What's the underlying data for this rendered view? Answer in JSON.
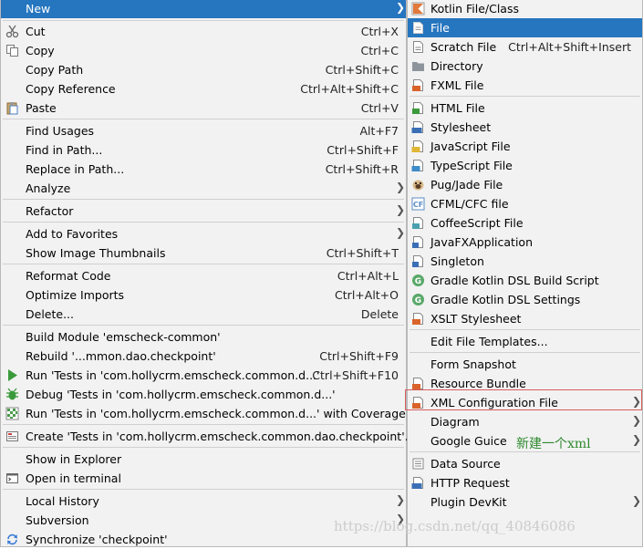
{
  "main_menu": {
    "new": "New",
    "cut": {
      "label": "Cut",
      "shortcut": "Ctrl+X"
    },
    "copy": {
      "label": "Copy",
      "shortcut": "Ctrl+C"
    },
    "copy_path": {
      "label": "Copy Path",
      "shortcut": "Ctrl+Shift+C"
    },
    "copy_reference": {
      "label": "Copy Reference",
      "shortcut": "Ctrl+Alt+Shift+C"
    },
    "paste": {
      "label": "Paste",
      "shortcut": "Ctrl+V"
    },
    "find_usages": {
      "label": "Find Usages",
      "shortcut": "Alt+F7"
    },
    "find_in_path": {
      "label": "Find in Path...",
      "shortcut": "Ctrl+Shift+F"
    },
    "replace_in_path": {
      "label": "Replace in Path...",
      "shortcut": "Ctrl+Shift+R"
    },
    "analyze": "Analyze",
    "refactor": "Refactor",
    "add_to_favorites": "Add to Favorites",
    "show_thumbnails": {
      "label": "Show Image Thumbnails",
      "shortcut": "Ctrl+Shift+T"
    },
    "reformat_code": {
      "label": "Reformat Code",
      "shortcut": "Ctrl+Alt+L"
    },
    "optimize_imports": {
      "label": "Optimize Imports",
      "shortcut": "Ctrl+Alt+O"
    },
    "delete": {
      "label": "Delete...",
      "shortcut": "Delete"
    },
    "build_module": "Build Module 'emscheck-common'",
    "rebuild": {
      "label": "Rebuild '...mmon.dao.checkpoint'",
      "shortcut": "Ctrl+Shift+F9"
    },
    "run_tests": {
      "label": "Run 'Tests in 'com.hollycrm.emscheck.common.d...'",
      "shortcut": "Ctrl+Shift+F10"
    },
    "debug_tests": "Debug 'Tests in 'com.hollycrm.emscheck.common.d...'",
    "run_coverage": "Run 'Tests in 'com.hollycrm.emscheck.common.d...' with Coverage",
    "create_tests": "Create 'Tests in 'com.hollycrm.emscheck.common.dao.checkpoint'...",
    "show_in_explorer": "Show in Explorer",
    "open_in_terminal": "Open in terminal",
    "local_history": "Local History",
    "subversion": "Subversion",
    "synchronize": "Synchronize 'checkpoint'"
  },
  "sub_menu": {
    "kotlin_file": "Kotlin File/Class",
    "file": "File",
    "scratch_file": {
      "label": "Scratch File",
      "shortcut": "Ctrl+Alt+Shift+Insert"
    },
    "directory": "Directory",
    "fxml_file": "FXML File",
    "html_file": "HTML File",
    "stylesheet": "Stylesheet",
    "javascript_file": "JavaScript File",
    "typescript_file": "TypeScript File",
    "pug_jade_file": "Pug/Jade File",
    "cfml_cfc_file": "CFML/CFC file",
    "coffeescript_file": "CoffeeScript File",
    "javafx_application": "JavaFXApplication",
    "singleton": "Singleton",
    "gradle_build_script": "Gradle Kotlin DSL Build Script",
    "gradle_settings": "Gradle Kotlin DSL Settings",
    "xslt_stylesheet": "XSLT Stylesheet",
    "edit_file_templates": "Edit File Templates...",
    "form_snapshot": "Form Snapshot",
    "resource_bundle": "Resource Bundle",
    "xml_configuration_file": "XML Configuration File",
    "diagram": "Diagram",
    "google_guice": "Google Guice",
    "data_source": "Data Source",
    "http_request": "HTTP Request",
    "plugin_devkit": "Plugin DevKit"
  },
  "annotation": "新建一个xml",
  "watermark": "https://blog.csdn.net/qq_40846086",
  "colors": {
    "selection": "#2675bf",
    "menu_bg": "#f2f2f2",
    "annotation": "#2f8a2f",
    "highlight_border": "#d95c5c"
  }
}
